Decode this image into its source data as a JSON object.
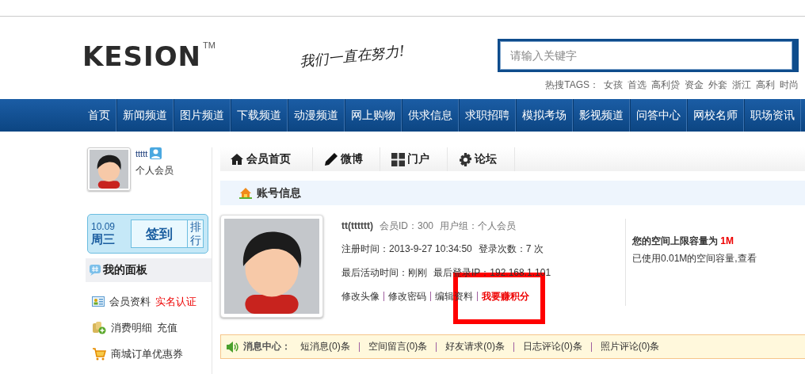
{
  "logo": {
    "text": "KESION",
    "mark": "TM"
  },
  "slogan": "我们一直在努力!",
  "search": {
    "placeholder": "请输入关键字"
  },
  "hot_tags": {
    "label": "热搜TAGS：",
    "tags": [
      "女孩",
      "首选",
      "高利贷",
      "资金",
      "外套",
      "浙江",
      "高利",
      "时尚"
    ]
  },
  "nav": [
    "首页",
    "新闻频道",
    "图片频道",
    "下载频道",
    "动漫频道",
    "网上购物",
    "供求信息",
    "求职招聘",
    "模拟考场",
    "影视频道",
    "问答中心",
    "网校名师",
    "职场资讯"
  ],
  "sidebar": {
    "user": {
      "name": "ttttt",
      "group": "个人会员"
    },
    "signin": {
      "date": "10.09",
      "weekday": "周三",
      "button": "签到",
      "rank": "排行"
    },
    "panel_title": "我的面板",
    "items": [
      {
        "label": "会员资料",
        "extra": "实名认证"
      },
      {
        "label": "消费明细",
        "extra": "充值"
      },
      {
        "label": "商城订单优惠券"
      }
    ]
  },
  "tabs": [
    {
      "label": "会员首页"
    },
    {
      "label": "微博"
    },
    {
      "label": "门户"
    },
    {
      "label": "论坛"
    }
  ],
  "section_title": "账号信息",
  "profile": {
    "name": "tt(tttttt)",
    "member_id": "会员ID：300",
    "group": "用户组：个人会员",
    "registered": "注册时间：2013-9-27 10:34:50",
    "logins": "登录次数：7 次",
    "activity": "最后活动时间：刚刚",
    "last_ip": "最后登录IP：192.168.1.101",
    "links": [
      {
        "label": "修改头像",
        "highlight": false
      },
      {
        "label": "修改密码",
        "highlight": false
      },
      {
        "label": "编辑资料",
        "highlight": false
      },
      {
        "label": "我要赚积分",
        "highlight": true
      }
    ]
  },
  "quota": {
    "limit": "您的空间上限容量为 **1M**",
    "used": "已使用0.01M的空间容量,查看"
  },
  "messages": {
    "title": "消息中心：",
    "items": [
      "短消息(0)条",
      "空间留言(0)条",
      "好友请求(0)条",
      "日志评论(0)条",
      "照片评论(0)条"
    ]
  }
}
